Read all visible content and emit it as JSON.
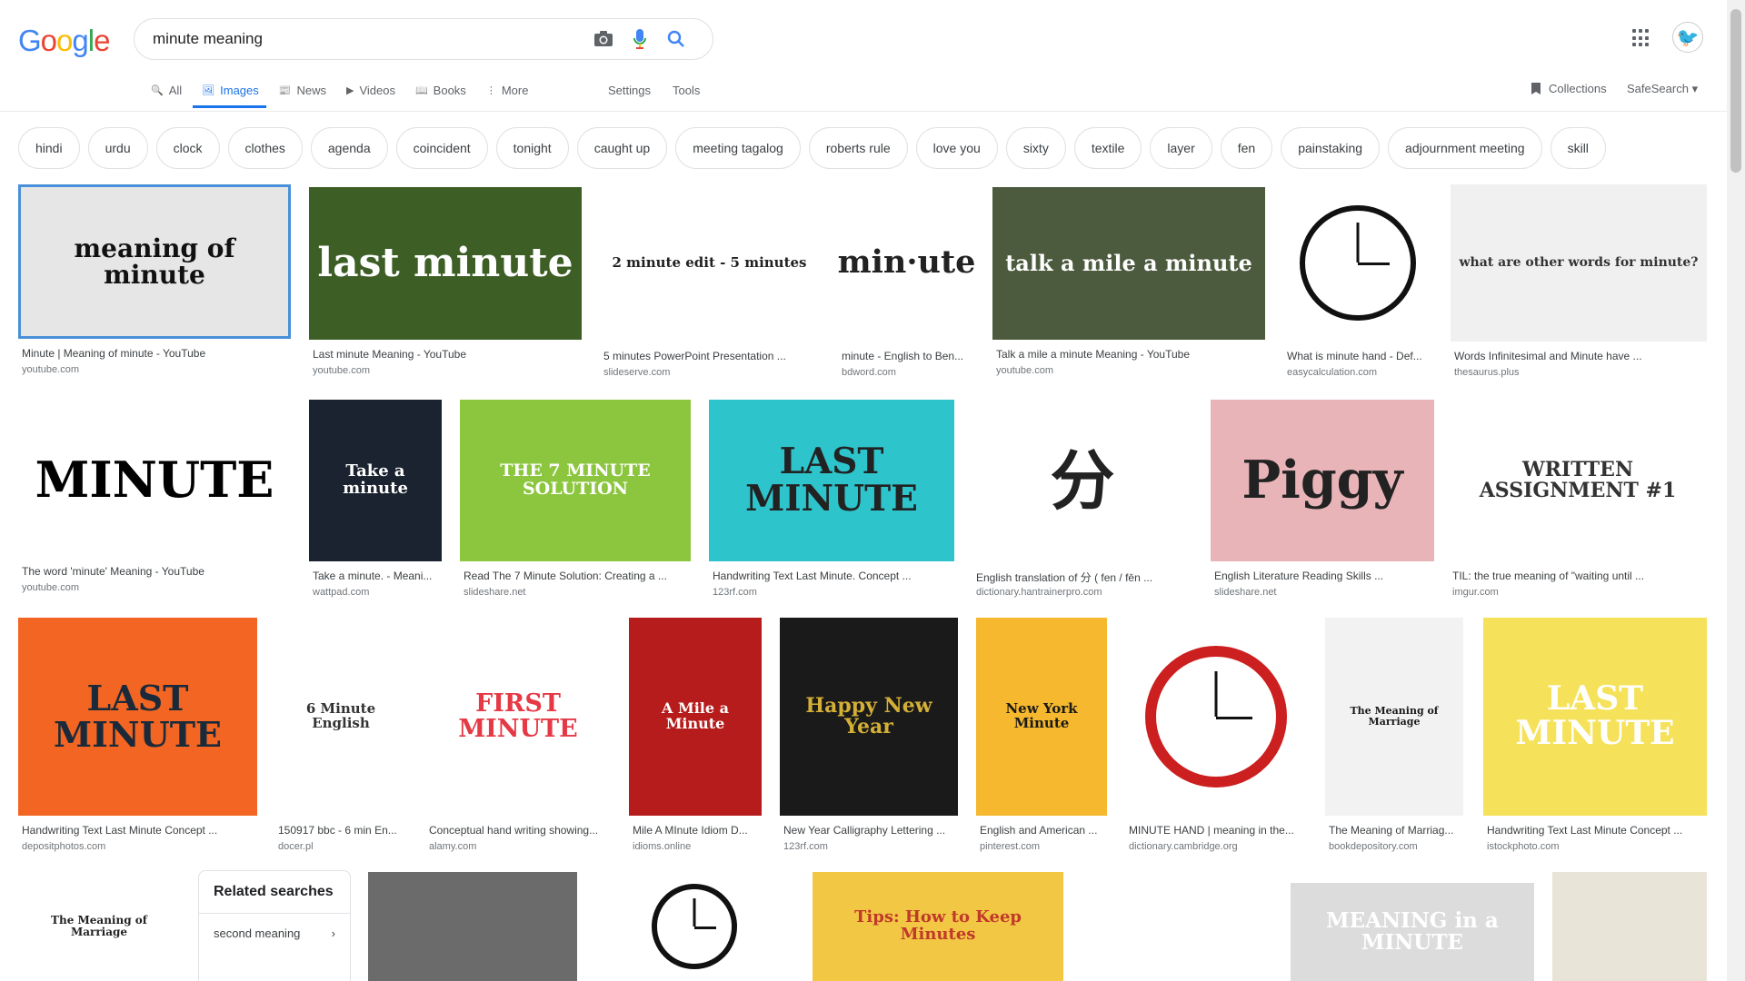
{
  "brand": {
    "logo_letters": [
      "G",
      "o",
      "o",
      "g",
      "l",
      "e"
    ],
    "logo_colors": [
      "#4285f4",
      "#ea4335",
      "#fbbc05",
      "#4285f4",
      "#34a853",
      "#ea4335"
    ]
  },
  "search": {
    "query": "minute meaning",
    "icons": [
      "camera-icon",
      "mic-icon",
      "search-icon"
    ]
  },
  "tabs": [
    {
      "label": "All",
      "icon": "search-icon",
      "active": false
    },
    {
      "label": "Images",
      "icon": "image-icon",
      "active": true
    },
    {
      "label": "News",
      "icon": "news-icon",
      "active": false
    },
    {
      "label": "Videos",
      "icon": "video-icon",
      "active": false
    },
    {
      "label": "Books",
      "icon": "book-icon",
      "active": false
    },
    {
      "label": "More",
      "icon": "more-icon",
      "active": false
    }
  ],
  "tools": {
    "settings": "Settings",
    "tools": "Tools",
    "collections": "Collections",
    "safesearch": "SafeSearch"
  },
  "chips": [
    "hindi",
    "urdu",
    "clock",
    "clothes",
    "agenda",
    "coincident",
    "tonight",
    "caught up",
    "meeting tagalog",
    "roberts rule",
    "love you",
    "sixty",
    "textile",
    "layer",
    "fen",
    "painstaking",
    "adjournment meeting",
    "skill"
  ],
  "results": [
    {
      "title": "Minute | Meaning of minute - YouTube",
      "source": "youtube.com",
      "thumb_text": "meaning of minute",
      "bg": "#e6e6e6",
      "fg": "#111111"
    },
    {
      "title": "Last minute Meaning - YouTube",
      "source": "youtube.com",
      "thumb_text": "last minute",
      "bg": "#3d5f26",
      "fg": "#ffffff"
    },
    {
      "title": "5 minutes PowerPoint Presentation ...",
      "source": "slideserve.com",
      "thumb_text": "2 minute edit - 5 minutes",
      "bg": "#ffffff",
      "fg": "#222222"
    },
    {
      "title": "minute - English to Ben...",
      "source": "bdword.com",
      "thumb_text": "min·ute",
      "bg": "#ffffff",
      "fg": "#222222"
    },
    {
      "title": "Talk a mile a minute Meaning - YouTube",
      "source": "youtube.com",
      "thumb_text": "talk a mile a minute",
      "bg": "#4c5a3e",
      "fg": "#ffffff"
    },
    {
      "title": "What is minute hand - Def...",
      "source": "easycalculation.com",
      "thumb_text": "minute hand",
      "bg": "#ffffff",
      "fg": "#000000"
    },
    {
      "title": "Words Infinitesimal and Minute have ...",
      "source": "thesaurus.plus",
      "thumb_text": "what are other words for minute?",
      "bg": "#f0f0f0",
      "fg": "#333333"
    },
    {
      "title": "The word 'minute' Meaning - YouTube",
      "source": "youtube.com",
      "thumb_text": "MINUTE",
      "bg": "#ffffff",
      "fg": "#000000"
    },
    {
      "title": "Take a minute. - Meani...",
      "source": "wattpad.com",
      "thumb_text": "Take a minute",
      "bg": "#1b2330",
      "fg": "#ffffff"
    },
    {
      "title": "Read The 7 Minute Solution: Creating a ...",
      "source": "slideshare.net",
      "thumb_text": "THE 7 MINUTE SOLUTION",
      "bg": "#8cc63f",
      "fg": "#ffffff"
    },
    {
      "title": "Handwriting Text Last Minute. Concept ...",
      "source": "123rf.com",
      "thumb_text": "LAST MINUTE",
      "bg": "#2ec4cc",
      "fg": "#222222"
    },
    {
      "title": "English translation of 分 ( fen / fēn ...",
      "source": "dictionary.hantrainerpro.com",
      "thumb_text": "分",
      "bg": "#ffffff",
      "fg": "#222222"
    },
    {
      "title": "English Literature Reading Skills ...",
      "source": "slideshare.net",
      "thumb_text": "Piggy",
      "bg": "#e8b4b8",
      "fg": "#222222"
    },
    {
      "title": "TIL: the true meaning of \"waiting until ...",
      "source": "imgur.com",
      "thumb_text": "WRITTEN ASSIGNMENT #1",
      "bg": "#ffffff",
      "fg": "#333333"
    },
    {
      "title": "Handwriting Text Last Minute Concept ...",
      "source": "depositphotos.com",
      "thumb_text": "LAST MINUTE",
      "bg": "#f26522",
      "fg": "#1a2a3a"
    },
    {
      "title": "150917 bbc - 6 min En...",
      "source": "docer.pl",
      "thumb_text": "6 Minute English",
      "bg": "#ffffff",
      "fg": "#333333"
    },
    {
      "title": "Conceptual hand writing showing...",
      "source": "alamy.com",
      "thumb_text": "FIRST MINUTE",
      "bg": "#ffffff",
      "fg": "#e63946"
    },
    {
      "title": "Mile A MInute Idiom D...",
      "source": "idioms.online",
      "thumb_text": "A Mile a Minute",
      "bg": "#b71c1c",
      "fg": "#ffffff"
    },
    {
      "title": "New Year Calligraphy Lettering ...",
      "source": "123rf.com",
      "thumb_text": "Happy New Year",
      "bg": "#1a1a1a",
      "fg": "#d4af37"
    },
    {
      "title": "English and American ...",
      "source": "pinterest.com",
      "thumb_text": "New York Minute",
      "bg": "#f5b82e",
      "fg": "#1a1a1a"
    },
    {
      "title": "MINUTE HAND | meaning in the...",
      "source": "dictionary.cambridge.org",
      "thumb_text": "",
      "bg": "#ffffff",
      "fg": "#cc0000"
    },
    {
      "title": "The Meaning of Marriag...",
      "source": "bookdepository.com",
      "thumb_text": "The Meaning of Marriage",
      "bg": "#f2f2f2",
      "fg": "#1a1a1a"
    },
    {
      "title": "Handwriting Text Last Minute Concept ...",
      "source": "istockphoto.com",
      "thumb_text": "LAST MINUTE",
      "bg": "#f6e25a",
      "fg": "#ffffff"
    },
    {
      "title": "",
      "source": "",
      "thumb_text": "The Meaning of Marriage",
      "bg": "#ffffff",
      "fg": "#222222"
    },
    {
      "title": "",
      "source": "",
      "thumb_text": "",
      "bg": "#6b6b6b",
      "fg": "#ffffff"
    },
    {
      "title": "",
      "source": "",
      "thumb_text": "",
      "bg": "#ffffff",
      "fg": "#222222"
    },
    {
      "title": "",
      "source": "",
      "thumb_text": "Tips: How to Keep Minutes",
      "bg": "#f2c744",
      "fg": "#c0392b"
    },
    {
      "title": "",
      "source": "",
      "thumb_text": "",
      "bg": "#ffffff",
      "fg": "#333333"
    },
    {
      "title": "",
      "source": "",
      "thumb_text": "MEANING in a MINUTE",
      "bg": "#dcdcdc",
      "fg": "#ffffff"
    },
    {
      "title": "",
      "source": "",
      "thumb_text": "",
      "bg": "#e9e4d8",
      "fg": "#333333"
    }
  ],
  "related": {
    "heading": "Related searches",
    "items": [
      {
        "label": "second meaning"
      }
    ]
  }
}
